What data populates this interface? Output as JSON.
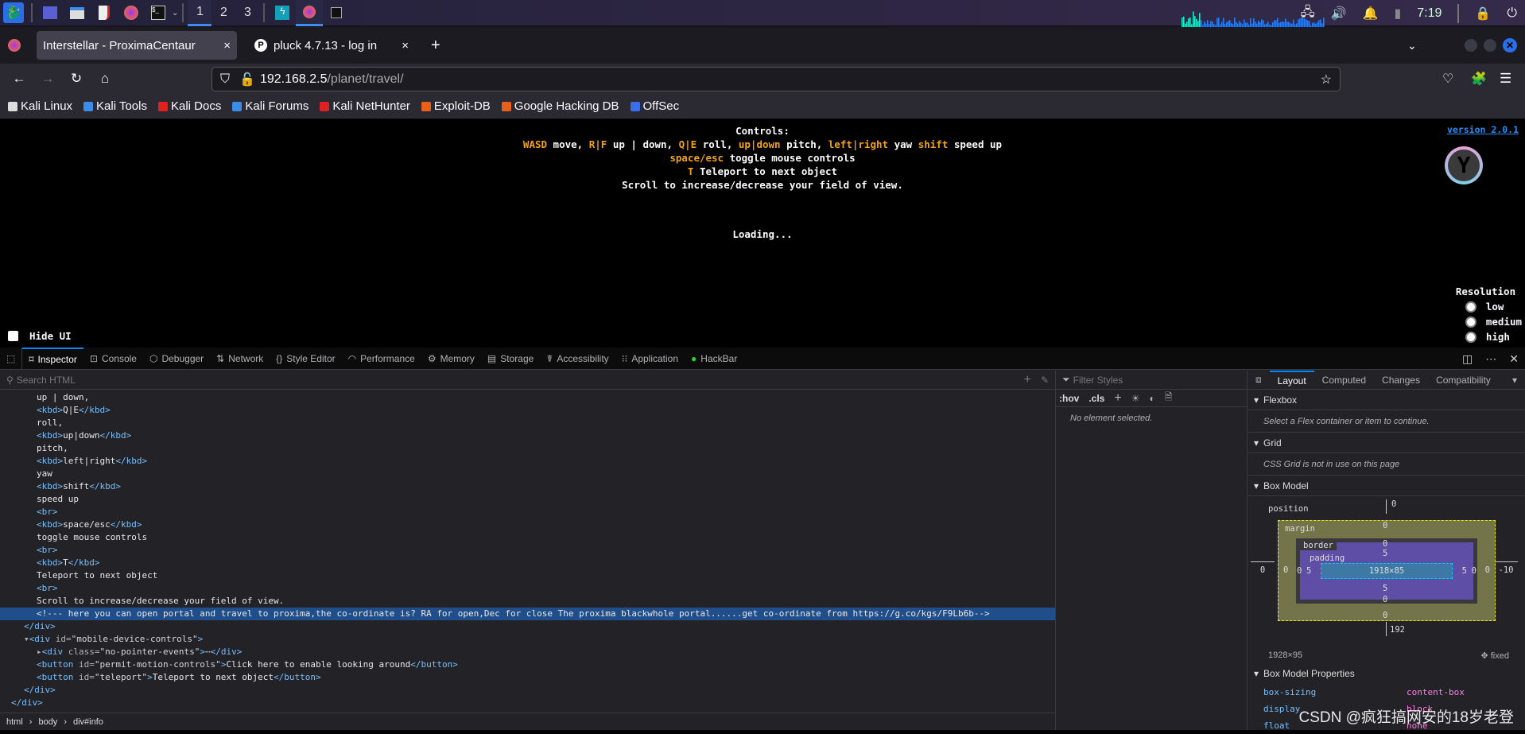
{
  "taskbar": {
    "workspaces": [
      "1",
      "2",
      "3"
    ],
    "active_workspace": "1",
    "clock": "7:19",
    "icons": [
      "kali-menu-icon",
      "desktop-icon",
      "file-manager-icon",
      "text-editor-icon",
      "firefox-icon",
      "terminal-icon",
      "burp-icon",
      "firefox-window-icon",
      "terminal-window-icon"
    ]
  },
  "tabs": [
    {
      "label": "Interstellar - ProximaCentaur",
      "close": "×"
    },
    {
      "label": "pluck 4.7.13 - log in",
      "close": "×",
      "favicon": "P"
    }
  ],
  "new_tab": "+",
  "url": {
    "host": "192.168.2.5",
    "path": "/planet/travel/"
  },
  "bookmarks": [
    "Kali Linux",
    "Kali Tools",
    "Kali Docs",
    "Kali Forums",
    "Kali NetHunter",
    "Exploit-DB",
    "Google Hacking DB",
    "OffSec"
  ],
  "page": {
    "controls_title": "Controls:",
    "line1": [
      [
        "k",
        "WASD"
      ],
      [
        "t",
        " move, "
      ],
      [
        "k",
        "R|F"
      ],
      [
        "t",
        " up | down, "
      ],
      [
        "k",
        "Q|E"
      ],
      [
        "t",
        " roll, "
      ],
      [
        "k",
        "up|down"
      ],
      [
        "t",
        " pitch, "
      ],
      [
        "k",
        "left|right"
      ],
      [
        "t",
        " yaw "
      ],
      [
        "k",
        "shift"
      ],
      [
        "t",
        " speed up"
      ]
    ],
    "line2": [
      [
        "k",
        "space/esc"
      ],
      [
        "t",
        " toggle mouse controls"
      ]
    ],
    "line3": [
      [
        "k",
        "T"
      ],
      [
        "t",
        " Teleport to next object"
      ]
    ],
    "line4": "Scroll to increase/decrease your field of view.",
    "loading": "Loading...",
    "version": "version 2.0.1",
    "resolution_label": "Resolution",
    "resolution_options": [
      "low",
      "medium",
      "high"
    ],
    "hide_ui": "Hide UI",
    "accent": "#f1a21a"
  },
  "devtools": {
    "tools": [
      "Inspector",
      "Console",
      "Debugger",
      "Network",
      "Style Editor",
      "Performance",
      "Memory",
      "Storage",
      "Accessibility",
      "Application",
      "HackBar"
    ],
    "active_tool": "Inspector",
    "search_placeholder": "Search HTML",
    "lines": [
      {
        "d": 3,
        "s": [
          [
            "x",
            "up | down,"
          ]
        ]
      },
      {
        "d": 3,
        "s": [
          [
            "t",
            "<kbd>"
          ],
          [
            "x",
            "Q|E"
          ],
          [
            "t",
            "</kbd>"
          ]
        ]
      },
      {
        "d": 3,
        "s": [
          [
            "x",
            "roll,"
          ]
        ]
      },
      {
        "d": 3,
        "s": [
          [
            "t",
            "<kbd>"
          ],
          [
            "x",
            "up|down"
          ],
          [
            "t",
            "</kbd>"
          ]
        ]
      },
      {
        "d": 3,
        "s": [
          [
            "x",
            "pitch,"
          ]
        ]
      },
      {
        "d": 3,
        "s": [
          [
            "t",
            "<kbd>"
          ],
          [
            "x",
            "left|right"
          ],
          [
            "t",
            "</kbd>"
          ]
        ]
      },
      {
        "d": 3,
        "s": [
          [
            "x",
            "yaw"
          ]
        ]
      },
      {
        "d": 3,
        "s": [
          [
            "t",
            "<kbd>"
          ],
          [
            "x",
            "shift"
          ],
          [
            "t",
            "</kbd>"
          ]
        ]
      },
      {
        "d": 3,
        "s": [
          [
            "x",
            "speed up"
          ]
        ]
      },
      {
        "d": 3,
        "s": [
          [
            "t",
            "<br>"
          ]
        ]
      },
      {
        "d": 3,
        "s": [
          [
            "t",
            "<kbd>"
          ],
          [
            "x",
            "space/esc"
          ],
          [
            "t",
            "</kbd>"
          ]
        ]
      },
      {
        "d": 3,
        "s": [
          [
            "x",
            "toggle mouse controls"
          ]
        ]
      },
      {
        "d": 3,
        "s": [
          [
            "t",
            "<br>"
          ]
        ]
      },
      {
        "d": 3,
        "s": [
          [
            "t",
            "<kbd>"
          ],
          [
            "x",
            "T"
          ],
          [
            "t",
            "</kbd>"
          ]
        ]
      },
      {
        "d": 3,
        "s": [
          [
            "x",
            "Teleport to next object"
          ]
        ]
      },
      {
        "d": 3,
        "s": [
          [
            "t",
            "<br>"
          ]
        ]
      },
      {
        "d": 3,
        "s": [
          [
            "x",
            "Scroll to increase/decrease your field of view."
          ]
        ]
      },
      {
        "d": 3,
        "hl": true,
        "s": [
          [
            "x",
            "<!--- here you can open portal and travel to proxima,the co-ordinate is? RA for open,Dec for close The proxima blackwhole portal......get co-ordinate from https://g.co/kgs/F9Lb6b-->"
          ]
        ]
      },
      {
        "d": 2,
        "s": [
          [
            "t",
            "</div>"
          ]
        ]
      },
      {
        "d": 2,
        "s": [
          [
            "a",
            "▾"
          ],
          [
            "t",
            "<div "
          ],
          [
            "a",
            "id="
          ],
          [
            "v",
            "\"mobile-device-controls\""
          ],
          [
            "t",
            ">"
          ]
        ]
      },
      {
        "d": 3,
        "s": [
          [
            "a",
            "▸"
          ],
          [
            "t",
            "<div "
          ],
          [
            "a",
            "class="
          ],
          [
            "v",
            "\"no-pointer-events\""
          ],
          [
            "t",
            ">"
          ],
          [
            "a",
            "⋯"
          ],
          [
            "t",
            "</div>"
          ]
        ]
      },
      {
        "d": 3,
        "s": [
          [
            "t",
            "<button "
          ],
          [
            "a",
            "id="
          ],
          [
            "v",
            "\"permit-motion-controls\""
          ],
          [
            "t",
            ">"
          ],
          [
            "x",
            "Click here to enable looking around"
          ],
          [
            "t",
            "</button>"
          ]
        ]
      },
      {
        "d": 3,
        "s": [
          [
            "t",
            "<button "
          ],
          [
            "a",
            "id="
          ],
          [
            "v",
            "\"teleport\""
          ],
          [
            "t",
            ">"
          ],
          [
            "x",
            "Teleport to next object"
          ],
          [
            "t",
            "</button>"
          ]
        ]
      },
      {
        "d": 2,
        "s": [
          [
            "t",
            "</div>"
          ]
        ]
      },
      {
        "d": 1,
        "s": [
          [
            "t",
            "</div>"
          ]
        ]
      }
    ],
    "breadcrumbs": [
      "html",
      "body",
      "div#info"
    ],
    "styles": {
      "filter_placeholder": "Filter Styles",
      "hov": ":hov",
      "cls": ".cls",
      "empty": "No element selected."
    },
    "layout": {
      "tabs": [
        "Layout",
        "Computed",
        "Changes",
        "Compatibility"
      ],
      "flexbox": "Flexbox",
      "flexbox_msg": "Select a Flex container or item to continue.",
      "grid": "Grid",
      "grid_msg": "CSS Grid is not in use on this page",
      "box_model": "Box Model",
      "box": {
        "position": "position",
        "pos_top": "0",
        "pos_left": "0",
        "pos_right": "-10",
        "pos_bottom": "192",
        "margin": "margin",
        "margin_vals": [
          "0",
          "0",
          "0",
          "0"
        ],
        "border": "border",
        "border_vals": [
          "0",
          "0",
          "0",
          "0"
        ],
        "padding": "padding",
        "padding_vals": [
          "5",
          "5",
          "5",
          "5"
        ],
        "content": "1918×85"
      },
      "size": "1928×95",
      "position_type": "fixed",
      "props_title": "Box Model Properties",
      "props": [
        [
          "box-sizing",
          "content-box"
        ],
        [
          "display",
          "block"
        ],
        [
          "float",
          "none"
        ]
      ]
    }
  },
  "watermark": "CSDN @疯狂搞网安的18岁老登"
}
